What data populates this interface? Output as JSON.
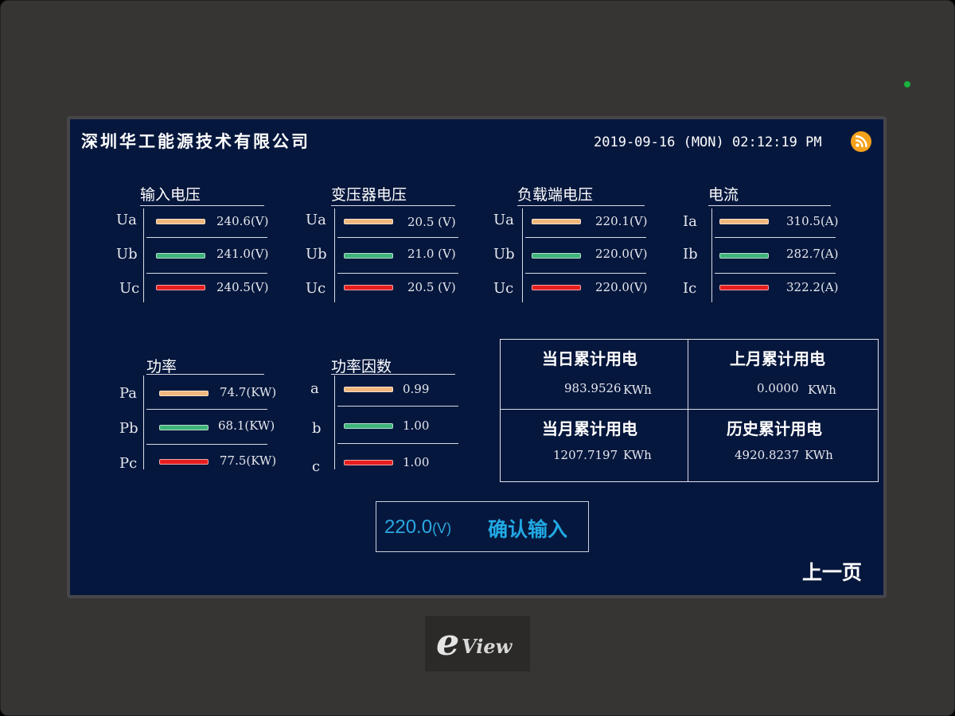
{
  "header": {
    "company": "深圳华工能源技术有限公司",
    "datetime": "2019-09-16 (MON) 02:12:19 PM"
  },
  "colors": {
    "phase_a": "#f0b77c",
    "phase_b": "#3fb37a",
    "phase_c": "#e61e1e",
    "screen_bg": "#06173d",
    "accent": "#21a9e4"
  },
  "panels": {
    "input_voltage": {
      "title": "输入电压",
      "rows": [
        {
          "label": "Ua",
          "value": "240.6(V)"
        },
        {
          "label": "Ub",
          "value": "241.0(V)"
        },
        {
          "label": "Uc",
          "value": "240.5(V)"
        }
      ]
    },
    "transformer_voltage": {
      "title": "变压器电压",
      "rows": [
        {
          "label": "Ua",
          "value": "20.5 (V)"
        },
        {
          "label": "Ub",
          "value": "21.0 (V)"
        },
        {
          "label": "Uc",
          "value": "20.5 (V)"
        }
      ]
    },
    "load_voltage": {
      "title": "负载端电压",
      "rows": [
        {
          "label": "Ua",
          "value": "220.1(V)"
        },
        {
          "label": "Ub",
          "value": "220.0(V)"
        },
        {
          "label": "Uc",
          "value": "220.0(V)"
        }
      ]
    },
    "current": {
      "title": "电流",
      "rows": [
        {
          "label": "Ia",
          "value": "310.5(A)"
        },
        {
          "label": "Ib",
          "value": "282.7(A)"
        },
        {
          "label": "Ic",
          "value": "322.2(A)"
        }
      ]
    },
    "power": {
      "title": "功率",
      "rows": [
        {
          "label": "Pa",
          "value": "74.7(KW)"
        },
        {
          "label": "Pb",
          "value": "68.1(KW)"
        },
        {
          "label": "Pc",
          "value": "77.5(KW)"
        }
      ]
    },
    "power_factor": {
      "title": "功率因数",
      "rows": [
        {
          "label": "a",
          "value": "0.99"
        },
        {
          "label": "b",
          "value": "1.00"
        },
        {
          "label": "c",
          "value": "1.00"
        }
      ]
    }
  },
  "energy": {
    "today": {
      "title": "当日累计用电",
      "value": "983.9526",
      "unit": "KWh"
    },
    "last_month": {
      "title": "上月累计用电",
      "value": "0.0000",
      "unit": "KWh"
    },
    "this_month": {
      "title": "当月累计用电",
      "value": "1207.7197",
      "unit": "KWh"
    },
    "history": {
      "title": "历史累计用电",
      "value": "4920.8237",
      "unit": "KWh"
    }
  },
  "input": {
    "value": "220.0",
    "unit": "(V)",
    "confirm_label": "确认输入"
  },
  "nav": {
    "prev_label": "上一页"
  },
  "brand": {
    "logo_e": "e",
    "logo_view": "View"
  }
}
